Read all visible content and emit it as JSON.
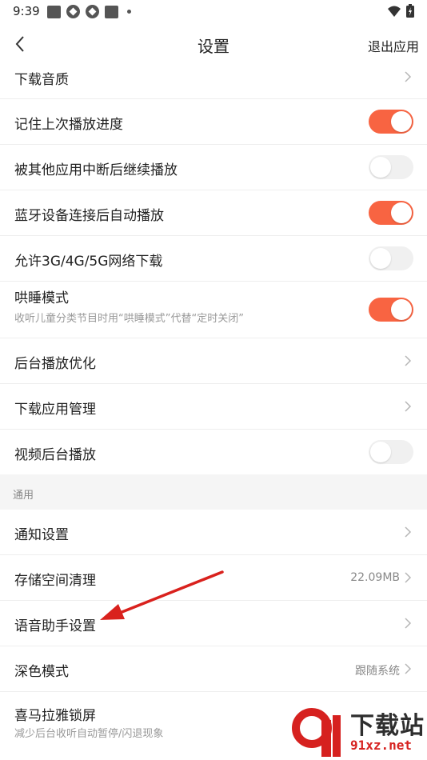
{
  "status_bar": {
    "time": "9:39"
  },
  "header": {
    "title": "设置",
    "exit_label": "退出应用"
  },
  "rows": {
    "download_quality": {
      "label": "下载音质"
    },
    "remember_progress": {
      "label": "记住上次播放进度",
      "enabled": true
    },
    "resume_after_interrupt": {
      "label": "被其他应用中断后继续播放",
      "enabled": false
    },
    "bluetooth_autoplay": {
      "label": "蓝牙设备连接后自动播放",
      "enabled": true
    },
    "cellular_download": {
      "label": "允许3G/4G/5G网络下载",
      "enabled": false
    },
    "sleep_mode": {
      "label": "哄睡模式",
      "subtitle": "收听儿童分类节目时用“哄睡模式”代替“定时关闭”",
      "enabled": true
    },
    "background_optimize": {
      "label": "后台播放优化"
    },
    "download_manager": {
      "label": "下载应用管理"
    },
    "video_background": {
      "label": "视频后台播放",
      "enabled": false
    },
    "section_general": {
      "label": "通用"
    },
    "notifications": {
      "label": "通知设置"
    },
    "storage_cleanup": {
      "label": "存储空间清理",
      "value": "22.09MB"
    },
    "voice_assistant": {
      "label": "语音助手设置"
    },
    "dark_mode": {
      "label": "深色模式",
      "value": "跟随系统"
    },
    "lockscreen": {
      "label": "喜马拉雅锁屏",
      "subtitle": "减少后台收听自动暂停/闪退现象"
    }
  },
  "watermark": {
    "line1": "下载站",
    "line2": "91xz.net"
  },
  "colors": {
    "accent": "#f86442",
    "annotation_arrow": "#d9211d"
  }
}
